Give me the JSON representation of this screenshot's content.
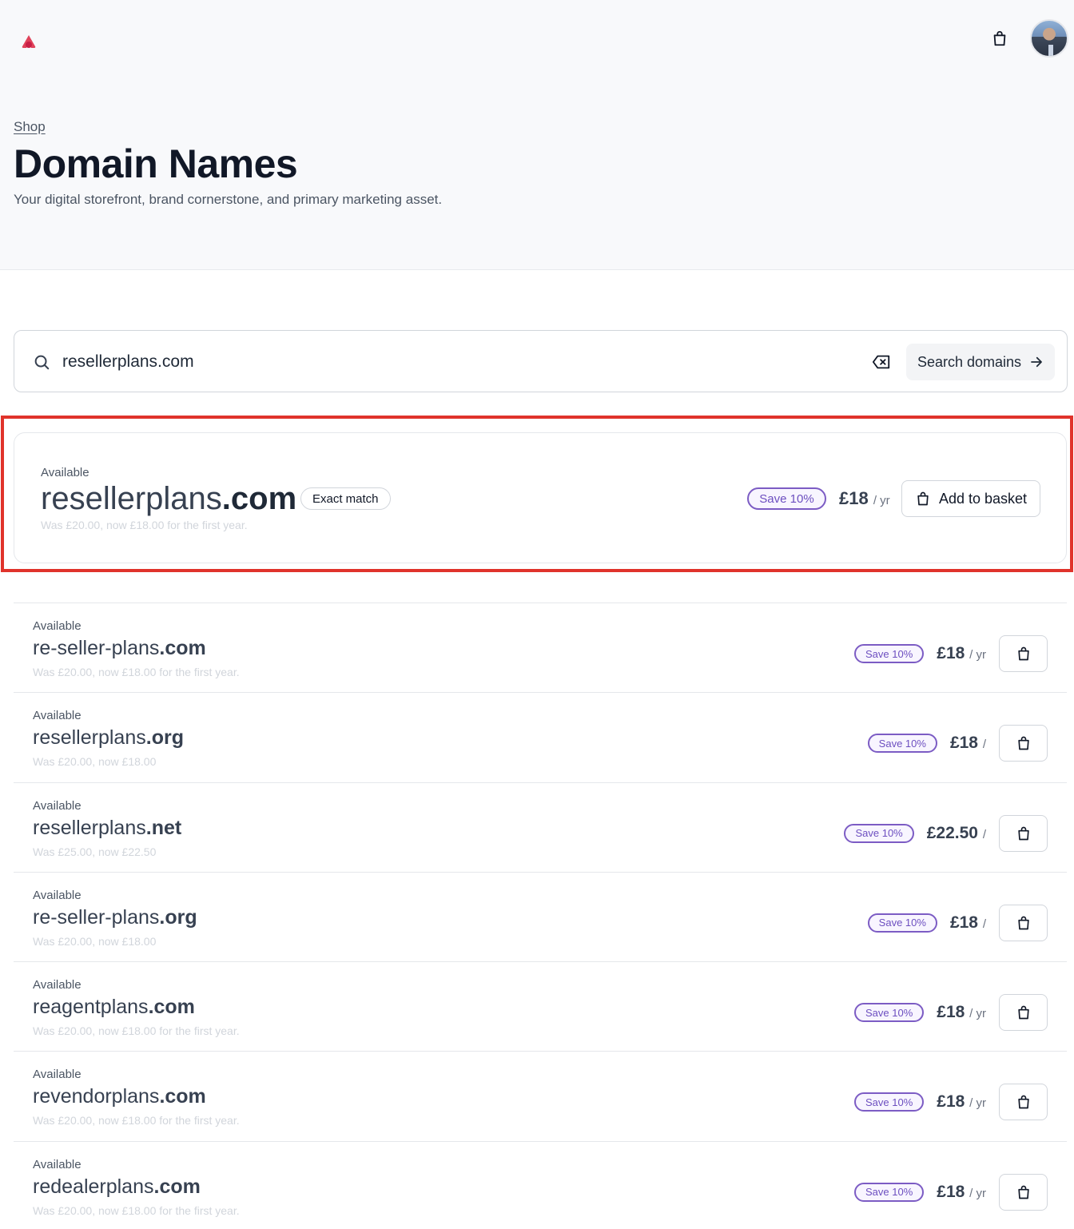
{
  "header": {
    "breadcrumb": "Shop",
    "title": "Domain Names",
    "subtitle": "Your digital storefront, brand cornerstone, and primary marketing asset.",
    "brand_color": "#e0435a"
  },
  "search": {
    "value": "resellerplans.com",
    "button_label": "Search domains"
  },
  "exact": {
    "status": "Available",
    "name_base": "resellerplans",
    "name_tld": ".com",
    "badge": "Exact match",
    "was_text": "Was £20.00, now £18.00 for the first year.",
    "save_label": "Save 10%",
    "price": "£18",
    "period": "/ yr",
    "basket_label": "Add to basket"
  },
  "results": [
    {
      "status": "Available",
      "name_base": "re-seller-plans",
      "name_tld": ".com",
      "was_text": "Was £20.00, now £18.00 for the first year.",
      "save_label": "Save 10%",
      "price": "£18",
      "period": "/ yr"
    },
    {
      "status": "Available",
      "name_base": "resellerplans",
      "name_tld": ".org",
      "was_text": "Was £20.00, now £18.00",
      "save_label": "Save 10%",
      "price": "£18",
      "period": "/"
    },
    {
      "status": "Available",
      "name_base": "resellerplans",
      "name_tld": ".net",
      "was_text": "Was £25.00, now £22.50",
      "save_label": "Save 10%",
      "price": "£22.50",
      "period": "/"
    },
    {
      "status": "Available",
      "name_base": "re-seller-plans",
      "name_tld": ".org",
      "was_text": "Was £20.00, now £18.00",
      "save_label": "Save 10%",
      "price": "£18",
      "period": "/"
    },
    {
      "status": "Available",
      "name_base": "reagentplans",
      "name_tld": ".com",
      "was_text": "Was £20.00, now £18.00 for the first year.",
      "save_label": "Save 10%",
      "price": "£18",
      "period": "/ yr"
    },
    {
      "status": "Available",
      "name_base": "revendorplans",
      "name_tld": ".com",
      "was_text": "Was £20.00, now £18.00 for the first year.",
      "save_label": "Save 10%",
      "price": "£18",
      "period": "/ yr"
    },
    {
      "status": "Available",
      "name_base": "redealerplans",
      "name_tld": ".com",
      "was_text": "Was £20.00, now £18.00 for the first year.",
      "save_label": "Save 10%",
      "price": "£18",
      "period": "/ yr"
    }
  ]
}
